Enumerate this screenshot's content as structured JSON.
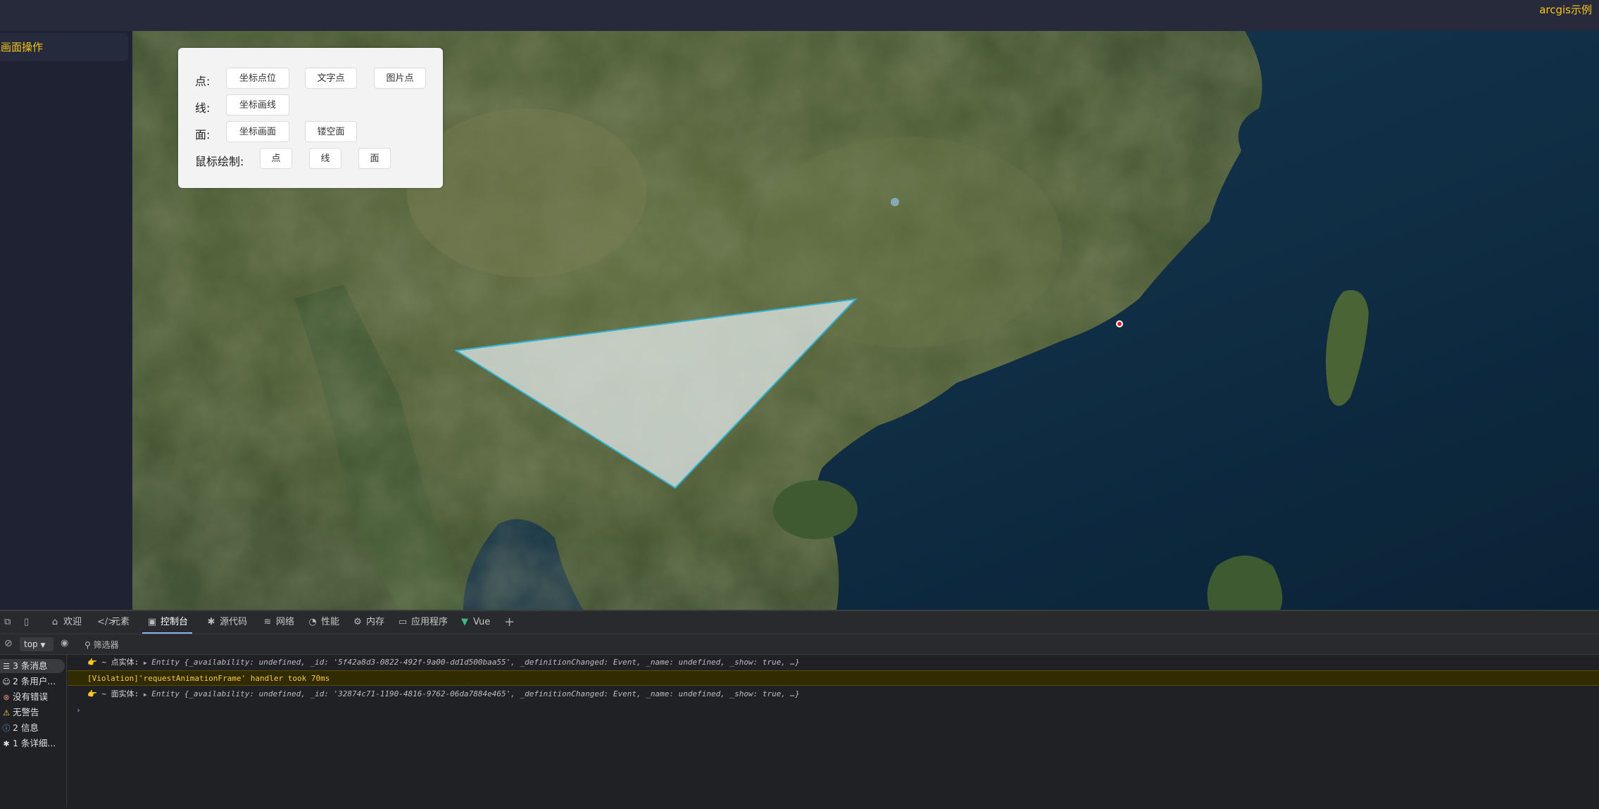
{
  "header": {
    "title": "arcgis示例"
  },
  "sidebar": {
    "active_item": "线画面操作"
  },
  "panel": {
    "rows": [
      {
        "label": "点:",
        "buttons": [
          "坐标点位",
          "文字点",
          "图片点"
        ]
      },
      {
        "label": "线:",
        "buttons": [
          "坐标画线"
        ]
      },
      {
        "label": "面:",
        "buttons": [
          "坐标画面",
          "镂空面"
        ]
      },
      {
        "label": "鼠标绘制:",
        "buttons": [
          "点",
          "线",
          "面"
        ]
      }
    ]
  },
  "devtools": {
    "tabs": [
      {
        "label": "欢迎",
        "icon": "home-icon"
      },
      {
        "label": "元素",
        "icon": "code-icon"
      },
      {
        "label": "控制台",
        "icon": "console-icon",
        "active": true
      },
      {
        "label": "源代码",
        "icon": "bug-icon"
      },
      {
        "label": "网络",
        "icon": "wifi-icon"
      },
      {
        "label": "性能",
        "icon": "gauge-icon"
      },
      {
        "label": "内存",
        "icon": "gear-icon"
      },
      {
        "label": "应用程序",
        "icon": "window-icon"
      },
      {
        "label": "Vue",
        "icon": "vue-icon"
      }
    ],
    "context": "top",
    "filter_label": "筛选器",
    "sidebar": [
      {
        "label": "3 条消息",
        "icon": "list-icon"
      },
      {
        "label": "2 条用户...",
        "icon": "user-icon"
      },
      {
        "label": "没有错误",
        "icon": "error-icon"
      },
      {
        "label": "无警告",
        "icon": "warning-icon"
      },
      {
        "label": "2 信息",
        "icon": "info-icon"
      },
      {
        "label": "1 条详细...",
        "icon": "bug-icon"
      }
    ],
    "logs": [
      {
        "prefix": "👉 ~ 点实体:",
        "entity": "Entity {_availability: undefined, _id: '5f42a8d3-0822-492f-9a00-dd1d500baa55', _definitionChanged: Event, _name: undefined, _show: true, …}"
      },
      {
        "violation": "[Violation]'requestAnimationFrame' handler took 70ms"
      },
      {
        "prefix": "👉 ~ 面实体:",
        "entity": "Entity {_availability: undefined, _id: '32874c71-1190-4816-9762-06da7884e465', _definitionChanged: Event, _name: undefined, _show: true, …}"
      }
    ]
  },
  "colors": {
    "accent": "#f5c518",
    "polygon_fill": "#e8eef0",
    "polygon_stroke": "#2fb4d6",
    "marker": "#e02020"
  }
}
